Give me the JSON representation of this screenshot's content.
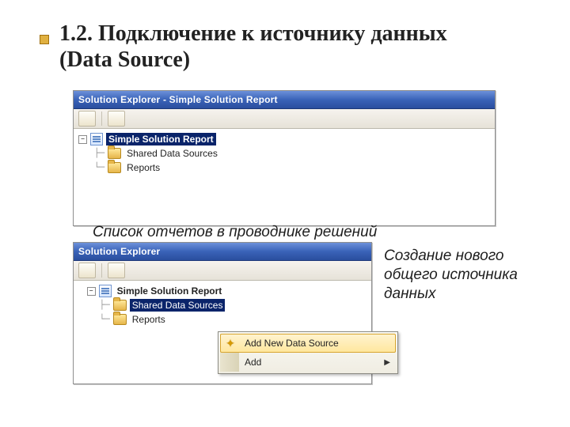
{
  "heading": "1.2. Подключение к источнику данных (Data Source)",
  "panel1": {
    "title": "Solution Explorer - Simple Solution Report",
    "root": "Simple Solution Report",
    "child1": "Shared Data Sources",
    "child2": "Reports"
  },
  "caption1": "Список отчетов в проводнике решений",
  "panel2": {
    "title": "Solution Explorer",
    "root": "Simple Solution Report",
    "child1": "Shared Data Sources",
    "child2": "Reports",
    "menu": {
      "item1": "Add New Data Source",
      "item2": "Add"
    }
  },
  "caption2": "Создание нового общего источника данных"
}
